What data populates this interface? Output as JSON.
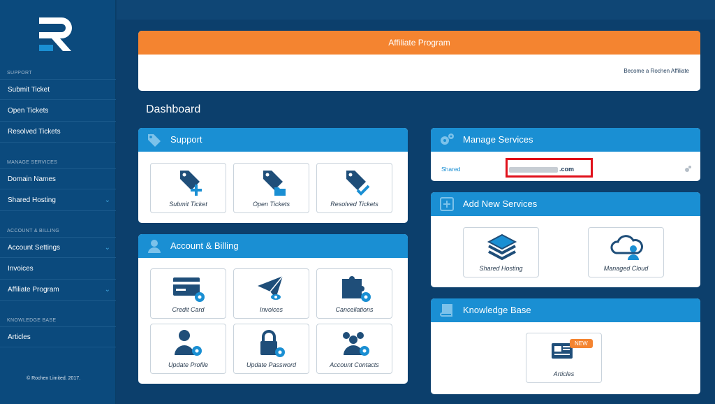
{
  "sidebar": {
    "sections": [
      "SUPPORT",
      "MANAGE SERVICES",
      "ACCOUNT & BILLING",
      "KNOWLEDGE BASE"
    ],
    "items": [
      {
        "label": "Submit Ticket"
      },
      {
        "label": "Open Tickets"
      },
      {
        "label": "Resolved Tickets"
      },
      {
        "label": "Domain Names"
      },
      {
        "label": "Shared Hosting"
      },
      {
        "label": "Account Settings"
      },
      {
        "label": "Invoices"
      },
      {
        "label": "Affiliate Program"
      },
      {
        "label": "Articles"
      }
    ],
    "copyright": "© Rochen Limited. 2017."
  },
  "affiliate": {
    "title": "Affiliate Program",
    "link": "Become a Rochen Affiliate"
  },
  "dashboard": {
    "title": "Dashboard"
  },
  "support": {
    "title": "Support",
    "tiles": [
      "Submit Ticket",
      "Open Tickets",
      "Resolved Tickets"
    ]
  },
  "billing": {
    "title": "Account & Billing",
    "tiles": [
      "Credit Card",
      "Invoices",
      "Cancellations",
      "Update Profile",
      "Update Password",
      "Account Contacts"
    ]
  },
  "manage_services": {
    "title": "Manage Services",
    "row_type": "Shared",
    "row_domain": ".com"
  },
  "add_services": {
    "title": "Add New Services",
    "tiles": [
      "Shared Hosting",
      "Managed Cloud"
    ]
  },
  "knowledge": {
    "title": "Knowledge Base",
    "tile": "Articles",
    "badge": "NEW"
  },
  "colors": {
    "brand_blue": "#1a8fd3",
    "orange": "#f48430",
    "navy": "#1f4e79"
  }
}
